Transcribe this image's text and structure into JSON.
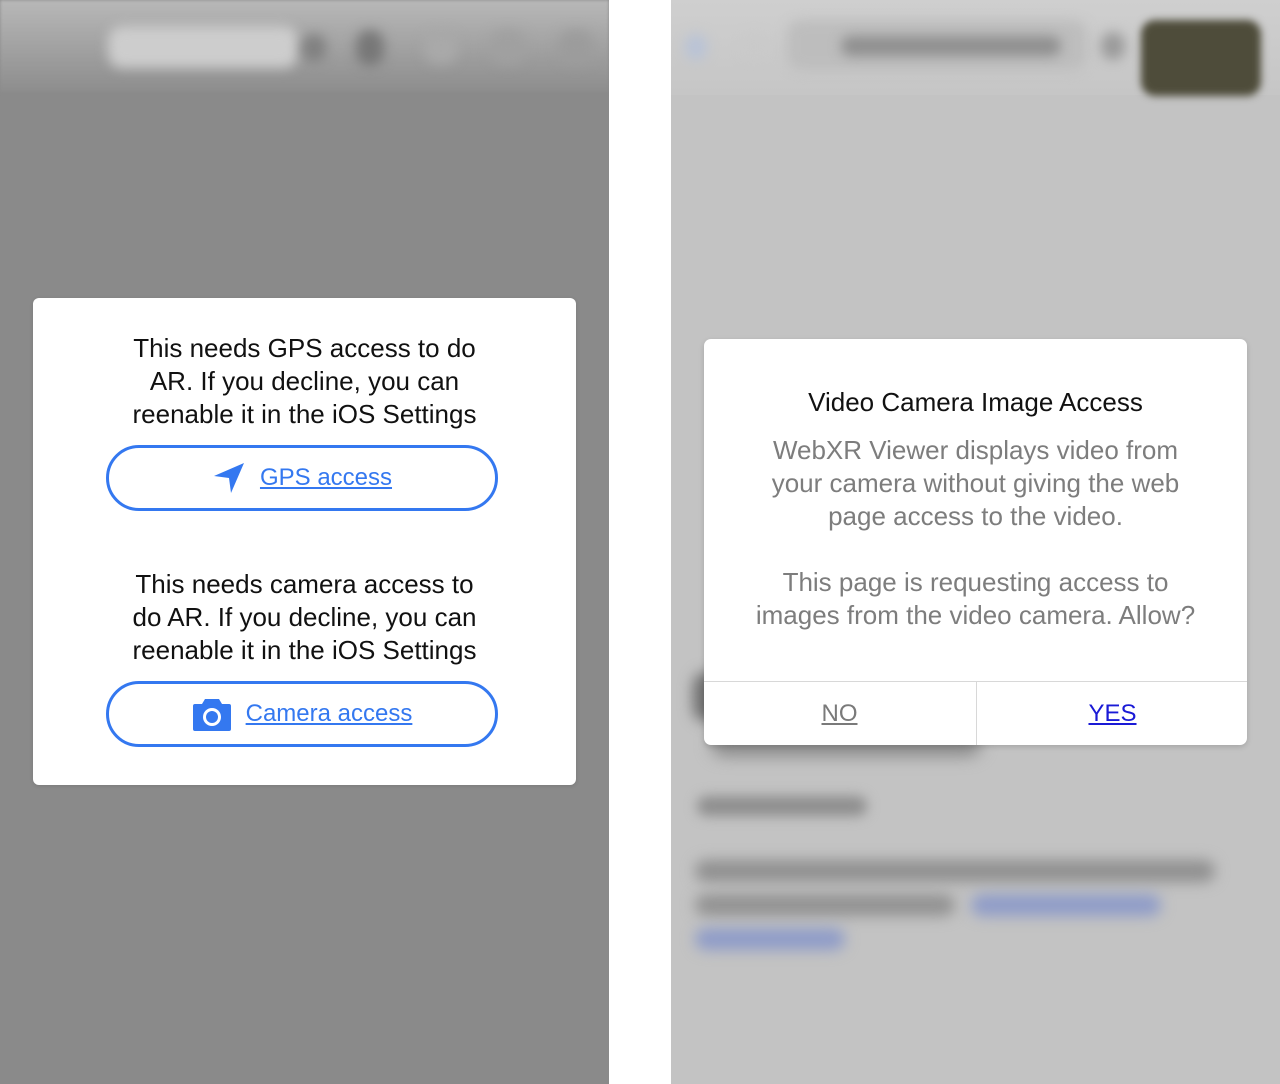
{
  "left": {
    "gps": {
      "message": "This needs GPS access to do\nAR. If you decline, you can\nreenable it in the iOS Settings",
      "button_label": "GPS access",
      "icon": "location-arrow-icon"
    },
    "camera": {
      "message": "This needs camera access to\ndo AR. If you decline, you can\nreenable it in the iOS Settings",
      "button_label": "Camera access",
      "icon": "camera-icon"
    }
  },
  "right": {
    "dialog": {
      "title": "Video Camera Image Access",
      "body_1": "WebXR Viewer displays video from\nyour camera without giving the web\npage access to the video.",
      "body_2": "This page is requesting access to\nimages from the video camera. Allow?",
      "no_label": "NO",
      "yes_label": "YES"
    }
  },
  "colors": {
    "accent": "#3478f0",
    "yes_link": "#1a1ad6",
    "no_link": "#7a7a7a"
  }
}
